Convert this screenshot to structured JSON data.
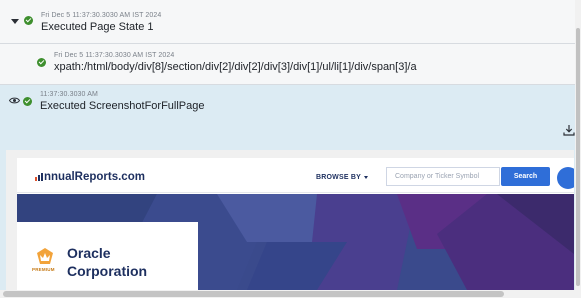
{
  "log": {
    "steps": [
      {
        "timestamp": "Fri Dec 5 11:37:30.3030 AM IST 2024",
        "message": "Executed Page State 1"
      },
      {
        "timestamp": "Fri Dec 5 11:37:30.3030 AM IST 2024",
        "message": "xpath:/html/body/div[8]/section/div[2]/div[2]/div[3]/div[1]/ul/li[1]/div/span[3]/a"
      },
      {
        "timestamp": "11:37:30.3030 AM",
        "message": "Executed ScreenshotForFullPage"
      }
    ]
  },
  "website": {
    "logo_text": "nnualReports.com",
    "browse_label": "BROWSE BY",
    "search_placeholder": "Company or Ticker Symbol",
    "search_button": "Search",
    "premium_label": "PREMIUM",
    "company_name": "Oracle Corporation"
  },
  "colors": {
    "status_success": "#3e8f2e",
    "selected_row": "#dcebf3",
    "brand_blue": "#2f6ed8",
    "brand_navy": "#1d2f5f",
    "banner": "#3a4a8c"
  }
}
